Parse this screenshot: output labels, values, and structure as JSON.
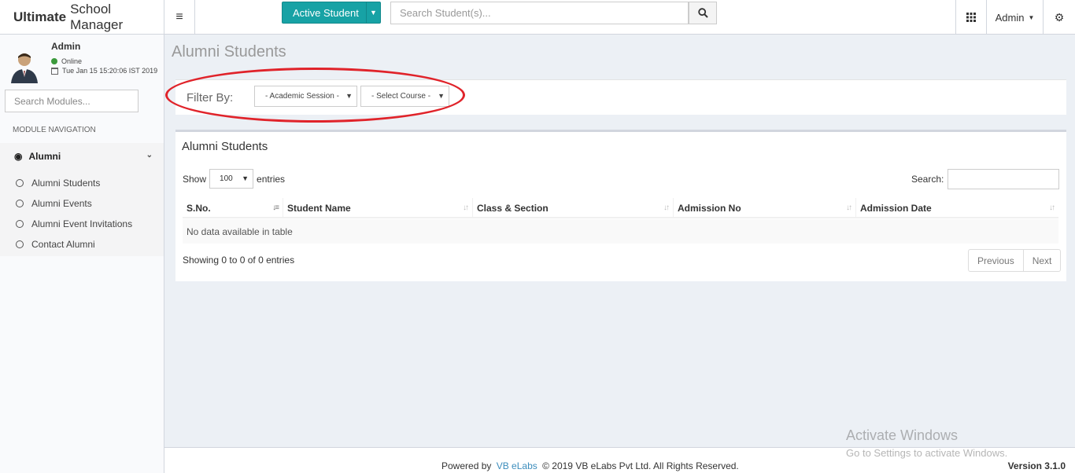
{
  "header": {
    "brand_bold": "Ultimate",
    "brand_rest": "School Manager",
    "active_button": "Active Student",
    "student_search_placeholder": "Search Student(s)...",
    "admin_label": "Admin"
  },
  "sidebar": {
    "user_name": "Admin",
    "status": "Online",
    "datetime": "Tue Jan 15 15:20:06 IST 2019",
    "module_search_placeholder": "Search Modules...",
    "nav_header": "MODULE NAVIGATION",
    "group_label": "Alumni",
    "items": [
      {
        "label": "Alumni Students"
      },
      {
        "label": "Alumni Events"
      },
      {
        "label": "Alumni Event Invitations"
      },
      {
        "label": "Contact Alumni"
      }
    ]
  },
  "main": {
    "page_title": "Alumni Students",
    "filter": {
      "label": "Filter By:",
      "session_select": "- Academic Session -",
      "course_select": "- Select Course -"
    },
    "table_box": {
      "title": "Alumni Students",
      "show_label": "Show",
      "page_length": "100",
      "entries_label": "entries",
      "search_label": "Search:",
      "columns": [
        "S.No.",
        "Student Name",
        "Class & Section",
        "Admission No",
        "Admission Date"
      ],
      "empty_message": "No data available in table",
      "info": "Showing 0 to 0 of 0 entries",
      "prev": "Previous",
      "next": "Next"
    }
  },
  "footer": {
    "powered_by": "Powered by",
    "link": "VB eLabs",
    "copyright": "© 2019 VB eLabs Pvt Ltd. All Rights Reserved.",
    "version_label": "Version",
    "version_number": "3.1.0"
  },
  "watermark": {
    "line1": "Activate Windows",
    "line2": "Go to Settings to activate Windows."
  },
  "colors": {
    "accent": "#17a2a5",
    "link": "#3c8dbc",
    "annotation": "#e0232a"
  }
}
